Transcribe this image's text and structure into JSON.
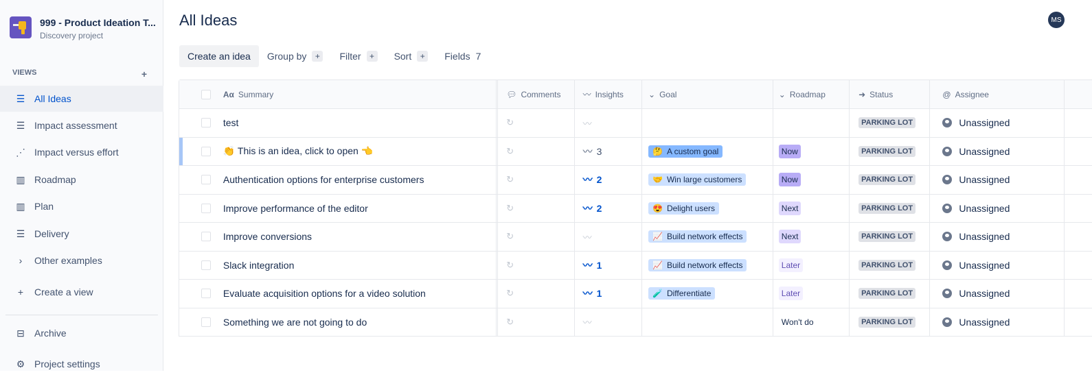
{
  "project": {
    "name": "999 - Product Ideation T...",
    "type": "Discovery project"
  },
  "sidebar": {
    "views_label": "VIEWS",
    "add": "+",
    "items": [
      {
        "label": "All Ideas",
        "icon": "☰"
      },
      {
        "label": "Impact assessment",
        "icon": "☰"
      },
      {
        "label": "Impact versus effort",
        "icon": "⋰"
      },
      {
        "label": "Roadmap",
        "icon": "▥"
      },
      {
        "label": "Plan",
        "icon": "▥"
      },
      {
        "label": "Delivery",
        "icon": "☰"
      },
      {
        "label": "Other examples",
        "icon": "›"
      },
      {
        "label": "Create a view",
        "icon": "+"
      },
      {
        "label": "Archive",
        "icon": "⊟"
      },
      {
        "label": "Project settings",
        "icon": "⚙"
      }
    ]
  },
  "header": {
    "title": "All Ideas",
    "avatar": "MS"
  },
  "toolbar": {
    "create": "Create an idea",
    "group_by": "Group by",
    "filter": "Filter",
    "sort": "Sort",
    "fields": "Fields",
    "fields_count": "7",
    "plus": "+"
  },
  "columns": {
    "summary": "Summary",
    "summary_icon": "Aα",
    "comments": "Comments",
    "insights": "Insights",
    "goal": "Goal",
    "roadmap": "Roadmap",
    "status": "Status",
    "assignee": "Assignee"
  },
  "rows": [
    {
      "summary": "test",
      "insights": "",
      "goal": "",
      "goal_emoji": "",
      "roadmap": "",
      "roadmap_kind": "",
      "status": "PARKING LOT",
      "assignee": "Unassigned"
    },
    {
      "summary": "👏 This is an idea, click to open 👈",
      "insights": "3",
      "goal": "A custom goal",
      "goal_emoji": "🤔",
      "roadmap": "Now",
      "roadmap_kind": "now",
      "status": "PARKING LOT",
      "assignee": "Unassigned"
    },
    {
      "summary": "Authentication options for enterprise customers",
      "insights": "2",
      "goal": "Win large customers",
      "goal_emoji": "🤝",
      "roadmap": "Now",
      "roadmap_kind": "now",
      "status": "PARKING LOT",
      "assignee": "Unassigned"
    },
    {
      "summary": "Improve performance of the editor",
      "insights": "2",
      "goal": "Delight users",
      "goal_emoji": "😍",
      "roadmap": "Next",
      "roadmap_kind": "next",
      "status": "PARKING LOT",
      "assignee": "Unassigned"
    },
    {
      "summary": "Improve conversions",
      "insights": "",
      "goal": "Build network effects",
      "goal_emoji": "📈",
      "roadmap": "Next",
      "roadmap_kind": "next",
      "status": "PARKING LOT",
      "assignee": "Unassigned"
    },
    {
      "summary": "Slack integration",
      "insights": "1",
      "goal": "Build network effects",
      "goal_emoji": "📈",
      "roadmap": "Later",
      "roadmap_kind": "later",
      "status": "PARKING LOT",
      "assignee": "Unassigned"
    },
    {
      "summary": "Evaluate acquisition options for a video solution",
      "insights": "1",
      "goal": "Differentiate",
      "goal_emoji": "🧪",
      "roadmap": "Later",
      "roadmap_kind": "later",
      "status": "PARKING LOT",
      "assignee": "Unassigned"
    },
    {
      "summary": "Something we are not going to do",
      "insights": "",
      "goal": "",
      "goal_emoji": "",
      "roadmap": "Won't do",
      "roadmap_kind": "wont",
      "status": "PARKING LOT",
      "assignee": "Unassigned"
    }
  ]
}
